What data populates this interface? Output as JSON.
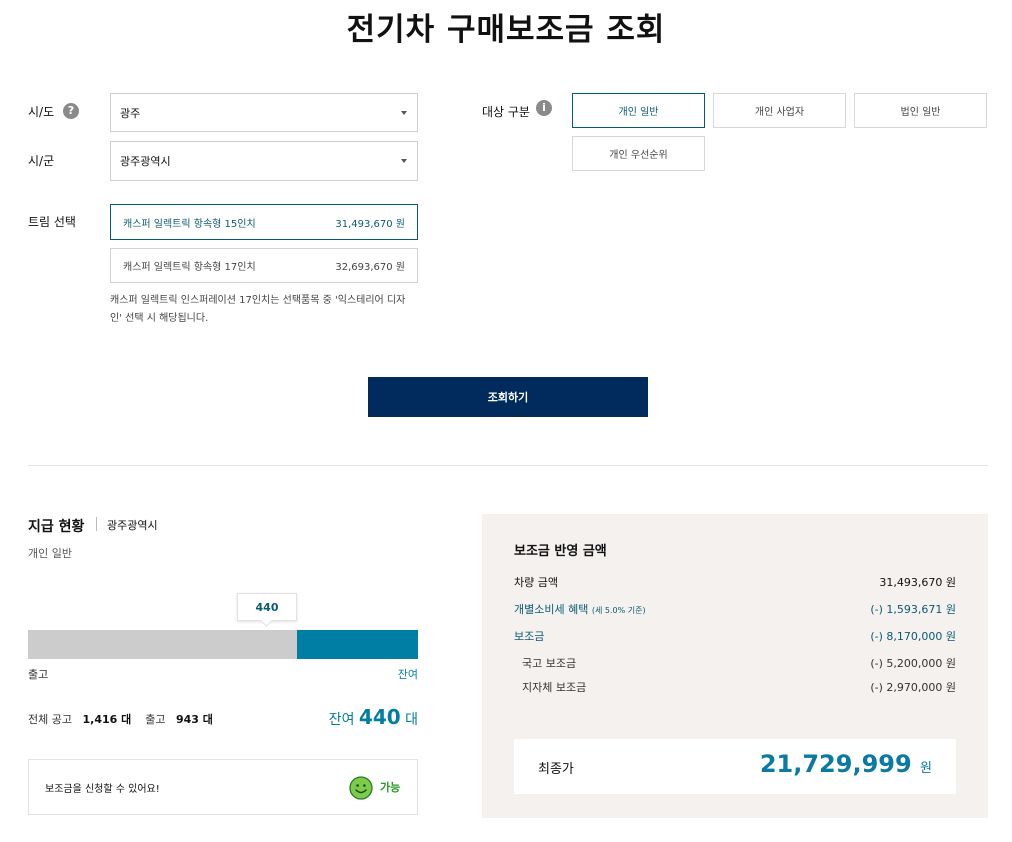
{
  "page_title": "전기차 구매보조금 조회",
  "form": {
    "sido_label": "시/도",
    "sido_help": "?",
    "sido_value": "광주",
    "sigun_label": "시/군",
    "sigun_value": "광주광역시",
    "target_label": "대상 구분",
    "target_help": "i",
    "target_options": [
      "개인 일반",
      "개인 사업자",
      "법인 일반",
      "개인 우선순위"
    ],
    "trim_label": "트림 선택",
    "trims": [
      {
        "name": "캐스퍼 일렉트릭 항속형 15인치",
        "price": "31,493,670 원"
      },
      {
        "name": "캐스퍼 일렉트릭 항속형 17인치",
        "price": "32,693,670 원"
      }
    ],
    "trim_note": "캐스퍼 일렉트릭 인스퍼레이션 17인치는 선택품목 중 '익스테리어 디자인' 선택 시 해당됩니다.",
    "search_button": "조회하기"
  },
  "status": {
    "title": "지급 현황",
    "region": "광주광역시",
    "type": "개인 일반",
    "bubble_value": "440",
    "remaining_fraction": 0.3107,
    "left_label": "출고",
    "right_label": "잔여",
    "total_label": "전체 공고",
    "total_value": "1,416 대",
    "shipped_label": "출고",
    "shipped_value": "943 대",
    "remain_label": "잔여",
    "remain_value": "440",
    "remain_unit": "대",
    "apply_text": "보조금을 신청할 수 있어요!",
    "apply_status": "가능"
  },
  "result": {
    "title": "보조금 반영 금액",
    "rows": [
      {
        "label": "차량 금액",
        "note": "",
        "value": "31,493,670 원"
      },
      {
        "label": "개별소비세 혜택",
        "note": "(세 5.0% 기준)",
        "value": "(-) 1,593,671 원"
      },
      {
        "label": "보조금",
        "note": "",
        "value": "(-) 8,170,000 원"
      },
      {
        "label": "국고 보조금",
        "note": "",
        "value": "(-) 5,200,000 원"
      },
      {
        "label": "지자체 보조금",
        "note": "",
        "value": "(-) 2,970,000 원"
      }
    ],
    "final_label": "최종가",
    "final_value": "21,729,999",
    "final_unit": "원"
  },
  "colors": {
    "accent": "#0b5a73",
    "button": "#002b5c",
    "bar_fill": "#007ea3",
    "bar_track": "#cccccc",
    "ok_green": "#2a9a2a"
  }
}
